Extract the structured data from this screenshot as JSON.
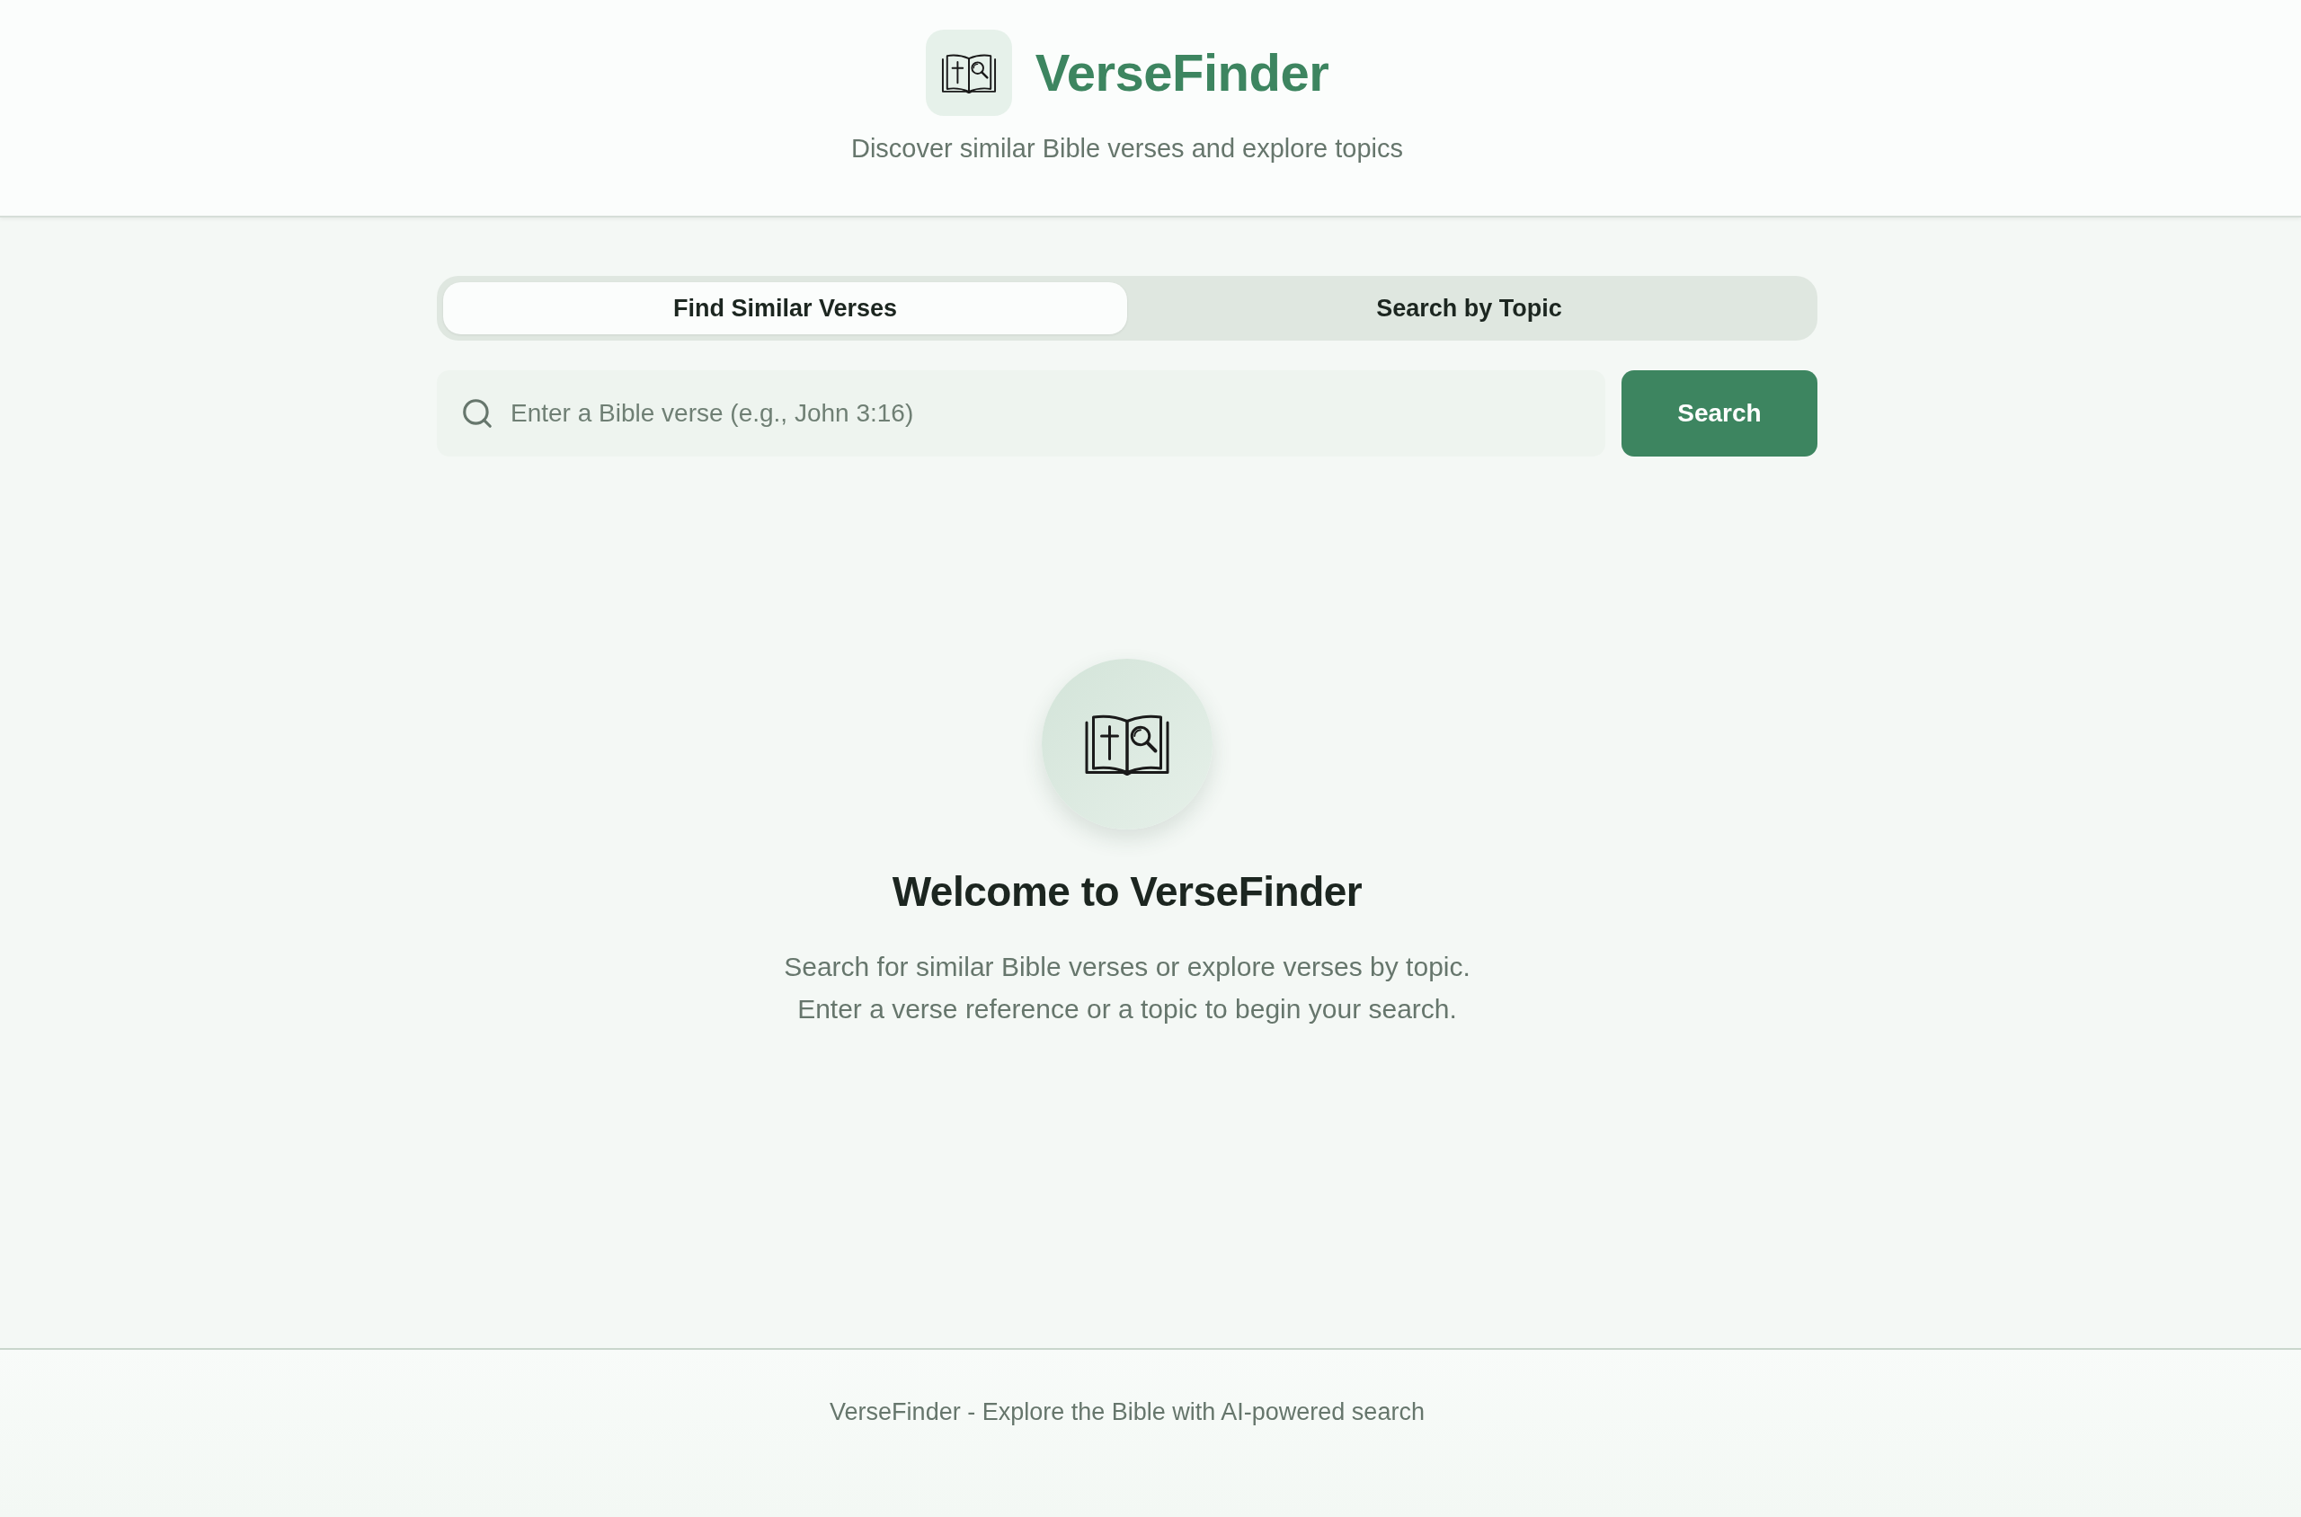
{
  "header": {
    "title": "VerseFinder",
    "subtitle": "Discover similar Bible verses and explore topics"
  },
  "tabs": [
    {
      "label": "Find Similar Verses",
      "selected": true
    },
    {
      "label": "Search by Topic",
      "selected": false
    }
  ],
  "search": {
    "placeholder": "Enter a Bible verse (e.g., John 3:16)",
    "button": "Search"
  },
  "welcome": {
    "title": "Welcome to VerseFinder",
    "description_lines": [
      "Search for similar Bible verses or explore verses by topic.",
      "Enter a verse reference or a topic to begin your search."
    ]
  },
  "footer": {
    "text": "VerseFinder - Explore the Bible with AI-powered search"
  }
}
